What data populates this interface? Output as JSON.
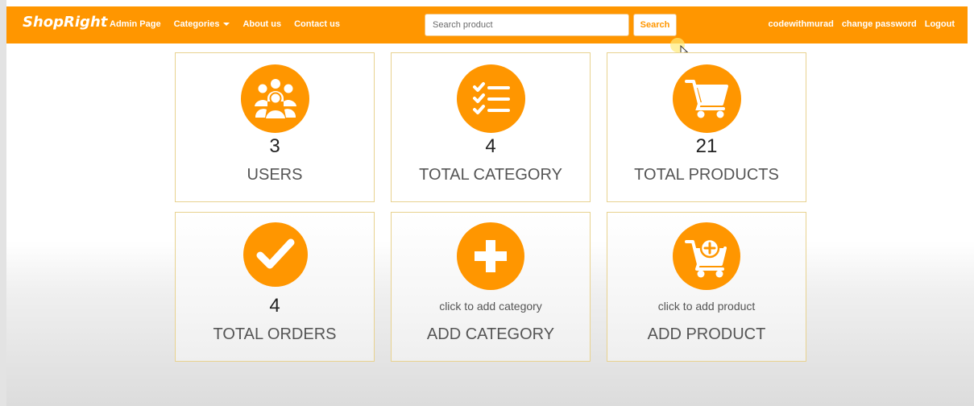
{
  "navbar": {
    "brand": "ShopRight",
    "links": [
      "Admin Page",
      "Categories",
      "About us",
      "Contact us"
    ],
    "search": {
      "placeholder": "Search product",
      "button": "Search"
    },
    "right_links": [
      "codewithmurad",
      "change password",
      "Logout"
    ]
  },
  "cards": [
    {
      "icon": "users-icon",
      "count": "3",
      "label": "USERS"
    },
    {
      "icon": "checklist-icon",
      "count": "4",
      "label": "TOTAL CATEGORY"
    },
    {
      "icon": "cart-icon",
      "count": "21",
      "label": "TOTAL PRODUCTS"
    },
    {
      "icon": "check-icon",
      "count": "4",
      "label": "TOTAL ORDERS"
    },
    {
      "icon": "plus-icon",
      "subtext": "click to add category",
      "label": "ADD CATEGORY"
    },
    {
      "icon": "cart-plus-icon",
      "subtext": "click to add product",
      "label": "ADD PRODUCT"
    }
  ],
  "colors": {
    "accent": "#ff9600",
    "card_border": "#e8d28f"
  }
}
